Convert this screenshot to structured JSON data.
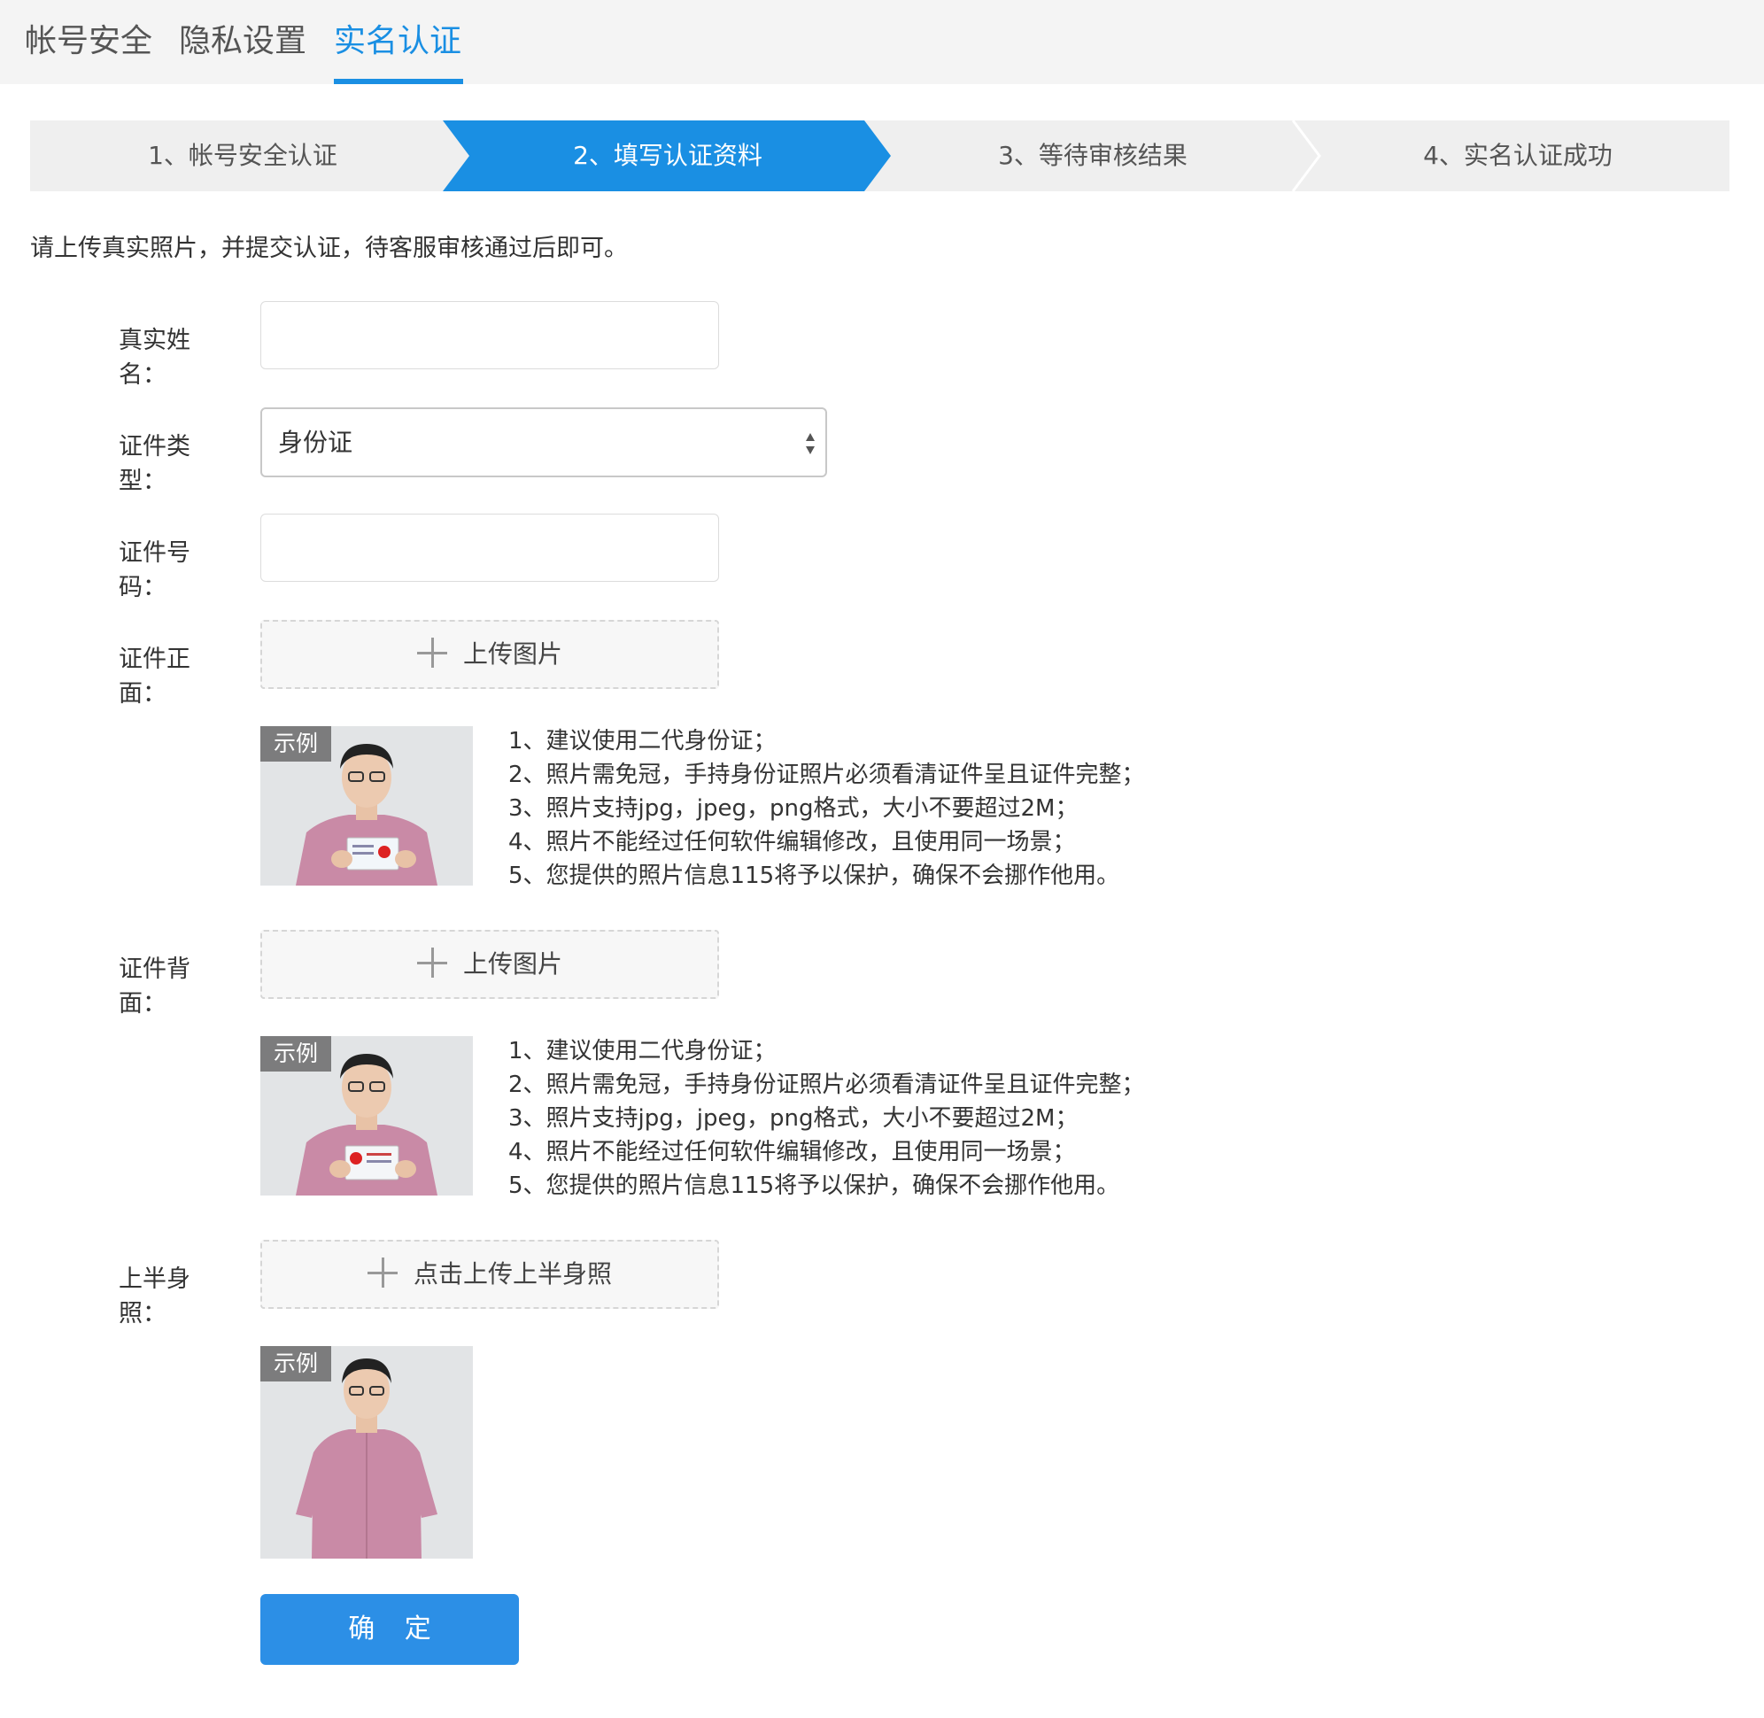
{
  "tabs": [
    {
      "label": "帐号安全"
    },
    {
      "label": "隐私设置"
    },
    {
      "label": "实名认证",
      "active": true
    }
  ],
  "steps": [
    {
      "label": "1、帐号安全认证"
    },
    {
      "label": "2、填写认证资料",
      "active": true
    },
    {
      "label": "3、等待审核结果"
    },
    {
      "label": "4、实名认证成功"
    }
  ],
  "intro": "请上传真实照片，并提交认证，待客服审核通过后即可。",
  "form": {
    "name_label": "真实姓名：",
    "name_value": "",
    "id_type_label": "证件类型：",
    "id_type_value": "身份证",
    "id_number_label": "证件号码：",
    "id_number_value": "",
    "front_label": "证件正面：",
    "front_upload": "上传图片",
    "back_label": "证件背面：",
    "back_upload": "上传图片",
    "upper_label": "上半身照：",
    "upper_upload": "点击上传上半身照",
    "example_badge": "示例",
    "submit": "确 定"
  },
  "tips": [
    "1、建议使用二代身份证；",
    "2、照片需免冠，手持身份证照片必须看清证件呈且证件完整；",
    "3、照片支持jpg，jpeg，png格式，大小不要超过2M；",
    "4、照片不能经过任何软件编辑修改，且使用同一场景；",
    "5、您提供的照片信息115将予以保护，确保不会挪作他用。"
  ],
  "colors": {
    "accent": "#1a8fe3",
    "button": "#2c8fe6",
    "topbar_bg": "#f4f4f4",
    "steps_bg": "#efefef"
  }
}
